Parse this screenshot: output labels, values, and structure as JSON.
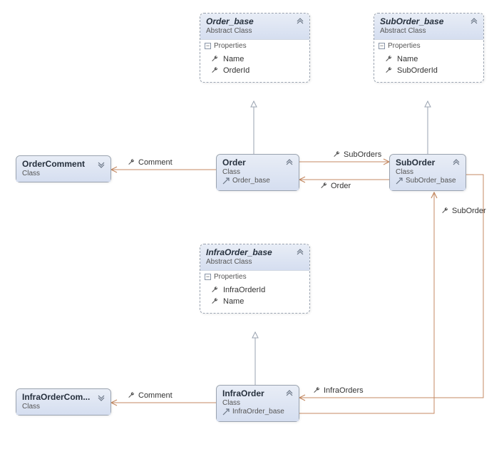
{
  "boxes": {
    "order_base": {
      "title": "Order_base",
      "subtitle": "Abstract Class",
      "section": "Properties",
      "props": [
        "Name",
        "OrderId"
      ]
    },
    "suborder_base": {
      "title": "SubOrder_base",
      "subtitle": "Abstract Class",
      "section": "Properties",
      "props": [
        "Name",
        "SubOrderId"
      ]
    },
    "order_comment": {
      "title": "OrderComment",
      "subtitle": "Class"
    },
    "order": {
      "title": "Order",
      "subtitle": "Class",
      "inherits": "Order_base"
    },
    "suborder": {
      "title": "SubOrder",
      "subtitle": "Class",
      "inherits": "SubOrder_base"
    },
    "infraorder_base": {
      "title": "InfraOrder_base",
      "subtitle": "Abstract Class",
      "section": "Properties",
      "props": [
        "InfraOrderId",
        "Name"
      ]
    },
    "infraorder": {
      "title": "InfraOrder",
      "subtitle": "Class",
      "inherits": "InfraOrder_base"
    },
    "infraorder_comment": {
      "title": "InfraOrderCom...",
      "subtitle": "Class"
    }
  },
  "labels": {
    "comment1": "Comment",
    "suborders": "SubOrders",
    "order_rel": "Order",
    "suborder_rel": "SubOrder",
    "infraorders": "InfraOrders",
    "comment2": "Comment"
  }
}
